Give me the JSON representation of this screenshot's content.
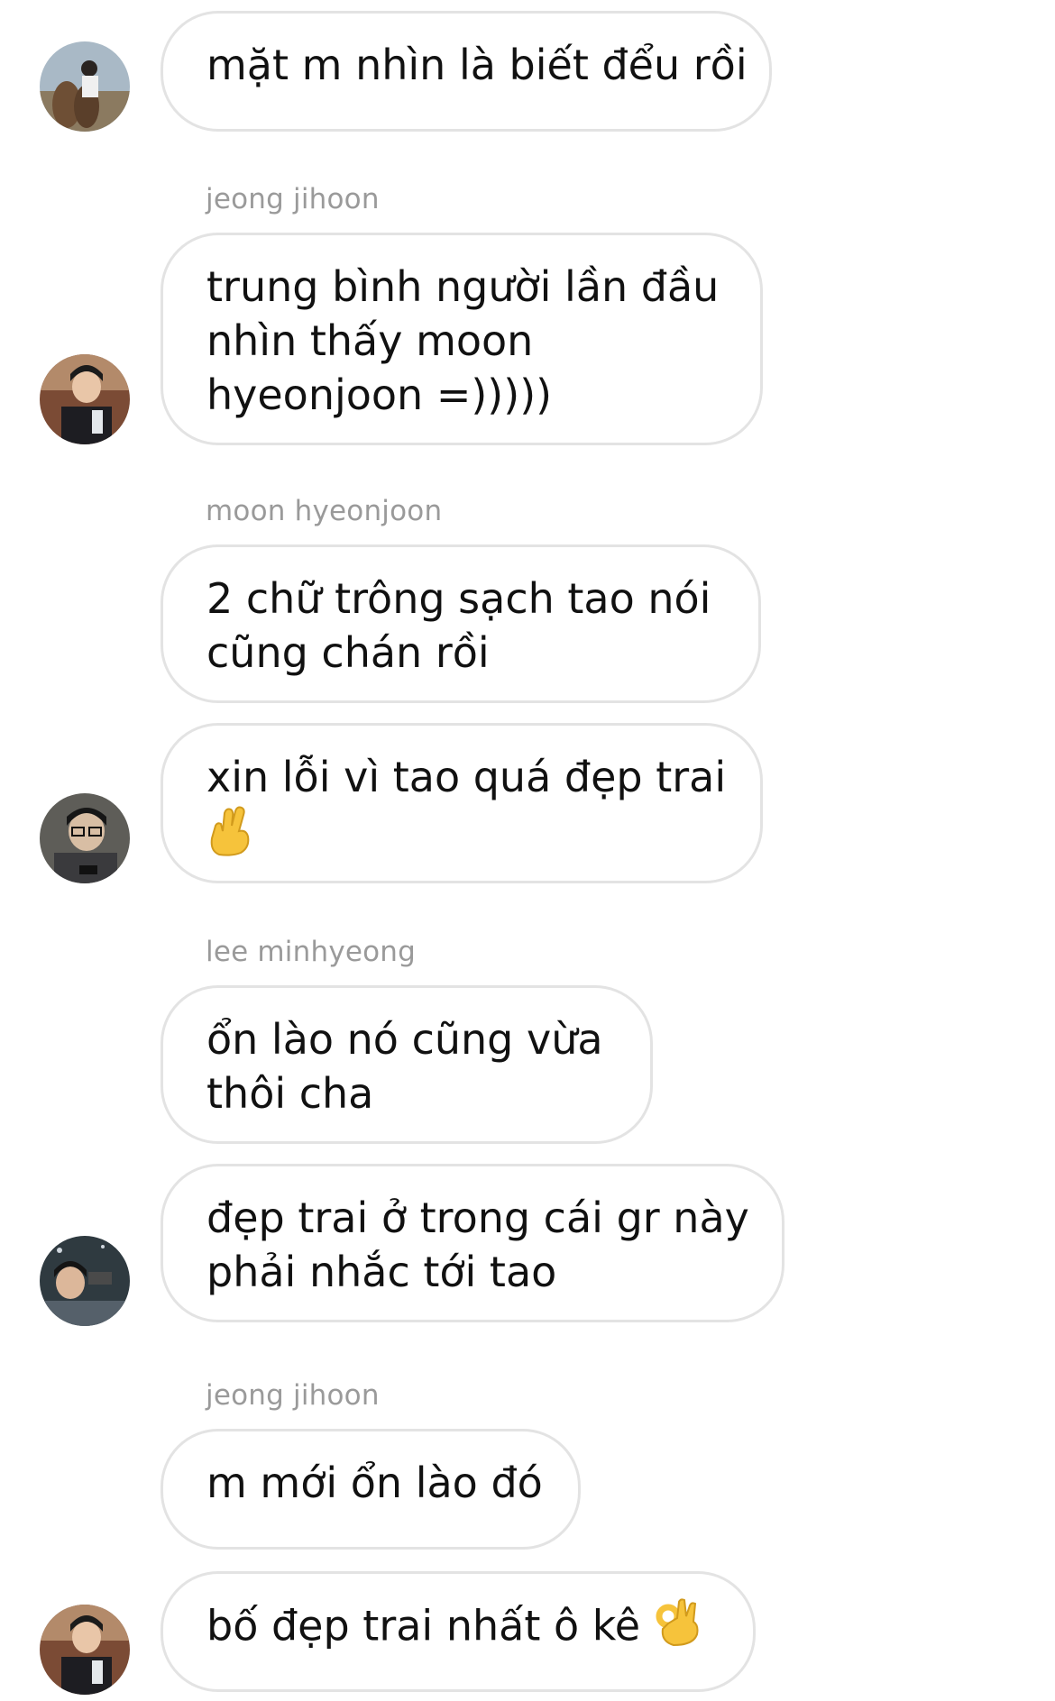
{
  "thread": {
    "messages": [
      {
        "id": "m1",
        "lines": [
          "mặt m nhìn là biết đểu rồi"
        ]
      },
      {
        "sender": "jeong jihoon",
        "id": "m2",
        "lines": [
          "trung bình người lần đầu",
          "nhìn thấy moon",
          "hyeonjoon =)))))"
        ]
      },
      {
        "sender": "moon hyeonjoon",
        "id": "m3",
        "lines": [
          "2 chữ trông sạch tao nói",
          "cũng chán rồi"
        ]
      },
      {
        "id": "m4",
        "lines": [
          "xin lỗi vì tao quá đẹp trai",
          ""
        ],
        "emoji": "crossed-fingers-emoji"
      },
      {
        "sender": "lee minhyeong",
        "id": "m5",
        "lines": [
          "ổn lào nó cũng vừa",
          "thôi cha"
        ]
      },
      {
        "id": "m6",
        "lines": [
          "đẹp trai ở trong cái gr này",
          "phải nhắc tới tao"
        ]
      },
      {
        "sender": "jeong jihoon",
        "id": "m7",
        "lines": [
          "m mới ổn lào đó"
        ]
      },
      {
        "id": "m8",
        "lines": [
          "bố đẹp trai nhất ô kê "
        ],
        "emoji": "ok-hand-emoji"
      }
    ]
  },
  "colors": {
    "bubble_border": "#e3e3e3",
    "sender_text": "#9a9a9a",
    "message_text": "#111111",
    "background": "#ffffff",
    "emoji_yellow": "#f6c33b"
  }
}
